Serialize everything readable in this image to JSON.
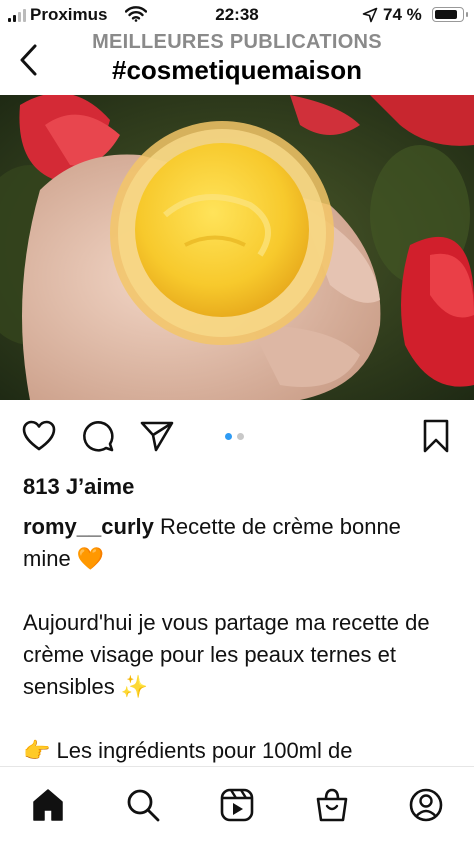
{
  "status_bar": {
    "carrier": "Proximus",
    "time": "22:38",
    "battery": "74 %",
    "battery_level": 0.74
  },
  "header": {
    "subtitle": "MEILLEURES PUBLICATIONS",
    "title": "#cosmetiquemaison"
  },
  "post": {
    "likes": "813 J’aime",
    "username": "romy__curly",
    "caption_lines": [
      "Recette de crème bonne mine 🧡",
      "Aujourd'hui je vous partage ma recette de crème visage pour les peaux ternes et sensibles ✨",
      "👉 Les ingrédients pour 100ml de"
    ],
    "carousel": {
      "count": 2,
      "active": 1
    }
  },
  "icons": {
    "back": "chevron-left-icon",
    "like": "heart-icon",
    "comment": "comment-icon",
    "share": "send-icon",
    "save": "bookmark-icon",
    "tabs": [
      "home-icon",
      "search-icon",
      "reels-icon",
      "shop-icon",
      "profile-icon"
    ]
  },
  "colors": {
    "accent": "#2f9bf4",
    "subtitle_gray": "#8a8a8a"
  }
}
